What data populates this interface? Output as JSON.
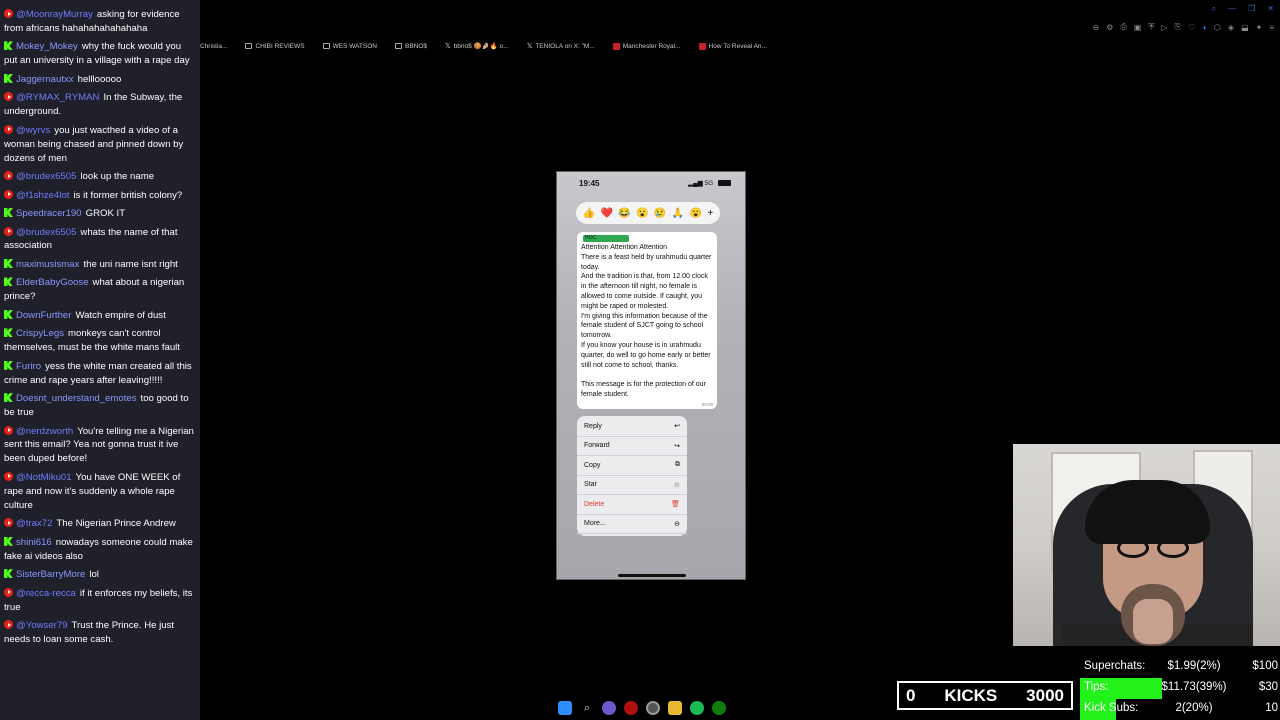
{
  "chat": {
    "messages": [
      {
        "platform": "yt",
        "user": "@MoonrayMurray",
        "text": "asking for evidence from africans hahahahahahahaha"
      },
      {
        "platform": "kick",
        "user": "Mokey_Mokey",
        "text": "why the fuck would you put an university in a village with a rape day"
      },
      {
        "platform": "kick",
        "user": "Jaggernautxx",
        "text": "helllooooo"
      },
      {
        "platform": "yt",
        "user": "@RYMAX_RYMAN",
        "text": "In the Subway, the underground."
      },
      {
        "platform": "yt",
        "user": "@wyrvs",
        "text": "you just wacthed a video of a woman being chased and pinned down by dozens of men"
      },
      {
        "platform": "yt",
        "user": "@brudex6505",
        "text": "look up the name"
      },
      {
        "platform": "yt",
        "user": "@f1shze4lot",
        "text": "is it former british colony?"
      },
      {
        "platform": "kick",
        "user": "Speedracer190",
        "text": "GROK IT"
      },
      {
        "platform": "yt",
        "user": "@brudex6505",
        "text": "whats the name of that association"
      },
      {
        "platform": "kick",
        "user": "maximusismax",
        "text": "the uni name isnt right"
      },
      {
        "platform": "kick",
        "user": "ElderBabyGoose",
        "text": "what about a nigerian prince?"
      },
      {
        "platform": "kick",
        "user": "DownFurther",
        "text": "Watch empire of dust"
      },
      {
        "platform": "kick",
        "user": "CrispyLegs",
        "text": "monkeys can't control themselves, must be the white mans fault"
      },
      {
        "platform": "kick",
        "user": "Furiro",
        "text": "yess the white man created all this crime and rape years after leaving!!!!!"
      },
      {
        "platform": "kick",
        "user": "Doesnt_understand_emotes",
        "text": "too good to be true"
      },
      {
        "platform": "yt",
        "user": "@nerdzworth",
        "text": "You're telling me a Nigerian sent this email? Yea not gonna trust it ive been duped before!"
      },
      {
        "platform": "yt",
        "user": "@NotMiku01",
        "text": "You have ONE WEEK of rape and now it's suddenly a whole rape culture"
      },
      {
        "platform": "yt",
        "user": "@trax72",
        "text": "The Nigerian Prince Andrew"
      },
      {
        "platform": "kick",
        "user": "shini616",
        "text": "nowadays someone could make fake ai videos also"
      },
      {
        "platform": "kick",
        "user": "SisterBarryMore",
        "text": "lol"
      },
      {
        "platform": "yt",
        "user": "@recca-recca",
        "text": "if it enforces my beliefs, its true"
      },
      {
        "platform": "yt",
        "user": "@Yowser79",
        "text": "Trust the Prince. He just needs to loan some cash."
      }
    ]
  },
  "browser": {
    "bookmarks": [
      {
        "icon": "none",
        "label": "Christia..."
      },
      {
        "icon": "folder",
        "label": "CHIBI REVIEWS"
      },
      {
        "icon": "folder",
        "label": "WES WATSON"
      },
      {
        "icon": "folder",
        "label": "BBNO$"
      },
      {
        "icon": "x",
        "label": "bbno$ 🍪🤌🏼🔥 o..."
      },
      {
        "icon": "x",
        "label": "TENIOLA on X: \"M..."
      },
      {
        "icon": "red",
        "label": "Manchester Royal..."
      },
      {
        "icon": "red",
        "label": "How To Reveal An..."
      }
    ]
  },
  "phone": {
    "time": "19:45",
    "network": "5G",
    "reactions": [
      "👍",
      "❤️",
      "😂",
      "😮",
      "😢",
      "🙏",
      "😮",
      "+"
    ],
    "sender": "HOC",
    "message": "Attention Attention Attention\nThere is a feast held by urahmudu quarter today.\nAnd the tradition is that, from 12.00 clock in the afternoon till night, no female is allowed to come outside. If caught, you might be raped or molested.\nI'm giving this information because of the female student of SJCT going to school tomorrow.\nIf you know your house is in urahmudu quarter, do well to go home early or better still not come to school, thanks.\n\nThis message is for the protection of our female student.",
    "message_time": "08:09",
    "menu": [
      {
        "label": "Reply",
        "icon": "↩"
      },
      {
        "label": "Forward",
        "icon": "↪"
      },
      {
        "label": "Copy",
        "icon": "⧉"
      },
      {
        "label": "Star",
        "icon": "☆"
      },
      {
        "label": "Delete",
        "icon": "🗑"
      },
      {
        "label": "More...",
        "icon": "⊖"
      }
    ]
  },
  "kicks": {
    "current": "0",
    "label": "KICKS",
    "goal": "3000"
  },
  "goals": [
    {
      "label": "Superchats:",
      "value": "$1.99(2%)",
      "target": "$100",
      "progress": 0.02
    },
    {
      "label": "Tips:",
      "value": "$11.73(39%)",
      "target": "$30",
      "progress": 0.39
    },
    {
      "label": "Kick Subs:",
      "value": "2(20%)",
      "target": "10",
      "progress": 0.2
    }
  ],
  "colors": {
    "chat_bg": "#1f2029",
    "youtube_badge": "#e62117",
    "kick_badge": "#53fc18",
    "goal_fill": "#22f21a",
    "delete_red": "#e53935"
  }
}
